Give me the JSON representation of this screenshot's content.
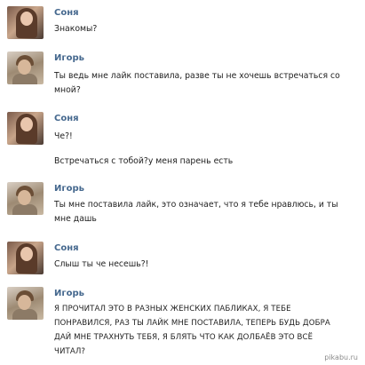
{
  "messages": [
    {
      "sender": "Соня",
      "avatar": "sonya",
      "lines": [
        "Знакомы?"
      ]
    },
    {
      "sender": "Игорь",
      "avatar": "igor",
      "lines": [
        "Ты ведь мне лайк поставила, разве ты не хочешь встречаться со",
        "мной?"
      ]
    },
    {
      "sender": "Соня",
      "avatar": "sonya",
      "lines": [
        "Че?!"
      ],
      "extra": "Встречаться с тобой?у меня парень есть"
    },
    {
      "sender": "Игорь",
      "avatar": "igor",
      "lines": [
        "Ты мне поставила лайк, это означает, что я тебе нравлюсь, и ты",
        "мне дашь"
      ]
    },
    {
      "sender": "Соня",
      "avatar": "sonya",
      "lines": [
        "Слыш ты че несешь?!"
      ]
    },
    {
      "sender": "Игорь",
      "avatar": "igor",
      "lines": [
        "Я ПРОЧИТАЛ ЭТО В РАЗНЫХ ЖЕНСКИХ ПАБЛИКАХ, Я ТЕБЕ",
        "ПОНРАВИЛСЯ, РАЗ ТЫ ЛАЙК МНЕ ПОСТАВИЛА, ТЕПЕРЬ БУДЬ ДОБРА",
        "ДАЙ МНЕ ТРАХНУТЬ ТЕБЯ, Я БЛЯТЬ ЧТО КАК ДОЛБАЁВ ЭТО ВСЁ",
        "ЧИТАЛ?"
      ]
    }
  ],
  "watermark": "pikabu.ru"
}
